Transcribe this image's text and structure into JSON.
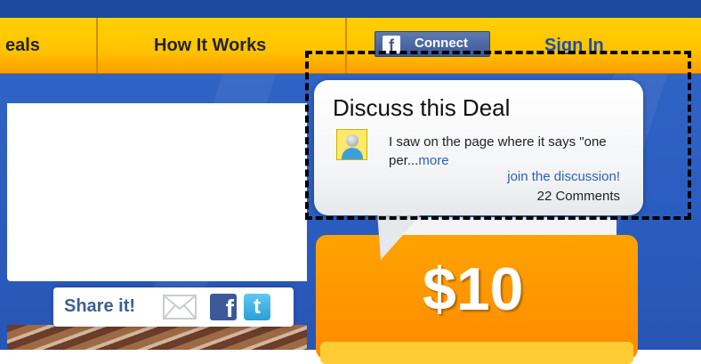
{
  "nav": {
    "items": [
      "eals",
      "How It Works",
      "Sign In"
    ],
    "connect_label": "Connect",
    "connect_icon": "f"
  },
  "discussion": {
    "title": "Discuss this Deal",
    "comment_text": "I saw on the page where it says \"one per...",
    "more_label": "more",
    "join_label": "join the discussion!",
    "comments_count": "22 Comments"
  },
  "share": {
    "label": "Share it!",
    "icons": [
      "email-icon",
      "facebook-icon",
      "twitter-icon"
    ],
    "facebook_glyph": "f",
    "twitter_glyph": "t"
  },
  "deal": {
    "price": "$10"
  },
  "colors": {
    "nav_yellow": "#ffc300",
    "page_blue": "#2a5dbf",
    "price_orange": "#ff9500",
    "link_blue": "#2d5fb8",
    "facebook_blue": "#3b5998"
  }
}
